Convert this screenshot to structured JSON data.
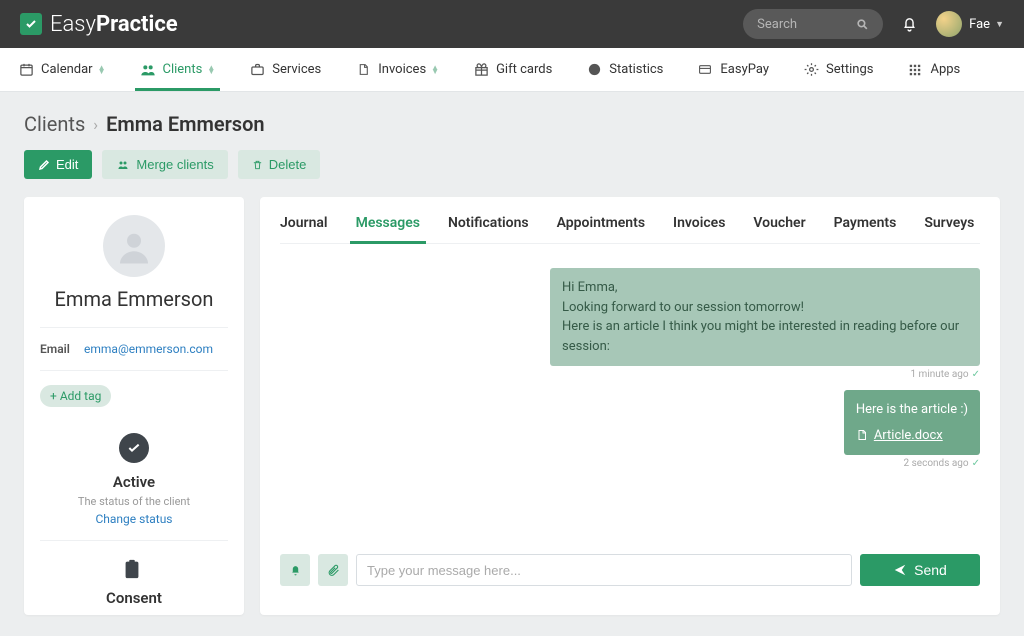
{
  "brand": {
    "name_light": "Easy",
    "name_bold": "Practice"
  },
  "search": {
    "placeholder": "Search"
  },
  "user": {
    "name": "Fae"
  },
  "nav": {
    "items": [
      {
        "label": "Calendar"
      },
      {
        "label": "Clients"
      },
      {
        "label": "Services"
      },
      {
        "label": "Invoices"
      },
      {
        "label": "Gift cards"
      },
      {
        "label": "Statistics"
      },
      {
        "label": "EasyPay"
      },
      {
        "label": "Settings"
      },
      {
        "label": "Apps"
      }
    ]
  },
  "breadcrumb": {
    "root": "Clients",
    "current": "Emma Emmerson"
  },
  "actions": {
    "edit": "Edit",
    "merge": "Merge clients",
    "delete": "Delete"
  },
  "client": {
    "name": "Emma Emmerson",
    "email_label": "Email",
    "email": "emma@emmerson.com",
    "add_tag": "Add tag",
    "status_title": "Active",
    "status_sub": "The status of the client",
    "status_link": "Change status",
    "consent_title": "Consent"
  },
  "tabs": [
    {
      "label": "Journal"
    },
    {
      "label": "Messages"
    },
    {
      "label": "Notifications"
    },
    {
      "label": "Appointments"
    },
    {
      "label": "Invoices"
    },
    {
      "label": "Voucher"
    },
    {
      "label": "Payments"
    },
    {
      "label": "Surveys"
    }
  ],
  "messages": {
    "m1_l1": "Hi Emma,",
    "m1_l2": "Looking forward to our session tomorrow!",
    "m1_l3": "Here is an article I think you might be interested in reading before our session:",
    "m1_meta": "1 minute ago",
    "m2_l1": "Here is the article :)",
    "m2_attach": "Article.docx",
    "m2_meta": "2 seconds ago"
  },
  "composer": {
    "placeholder": "Type your message here...",
    "send": "Send"
  }
}
